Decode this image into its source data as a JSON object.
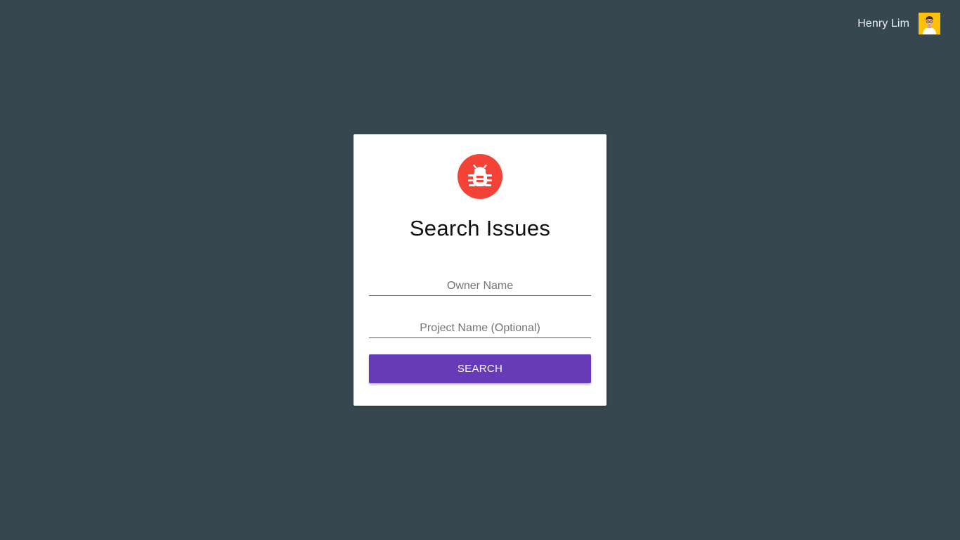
{
  "header": {
    "user_name": "Henry Lim",
    "avatar_icon": "user-avatar"
  },
  "card": {
    "logo_icon": "bug-icon",
    "title": "Search Issues",
    "owner_field": {
      "value": "",
      "placeholder": "Owner Name"
    },
    "project_field": {
      "value": "",
      "placeholder": "Project Name (Optional)"
    },
    "search_label": "SEARCH"
  },
  "colors": {
    "background": "#37474f",
    "card": "#ffffff",
    "logo_red": "#f44336",
    "button_purple": "#673ab7",
    "avatar_yellow": "#ffc107"
  }
}
